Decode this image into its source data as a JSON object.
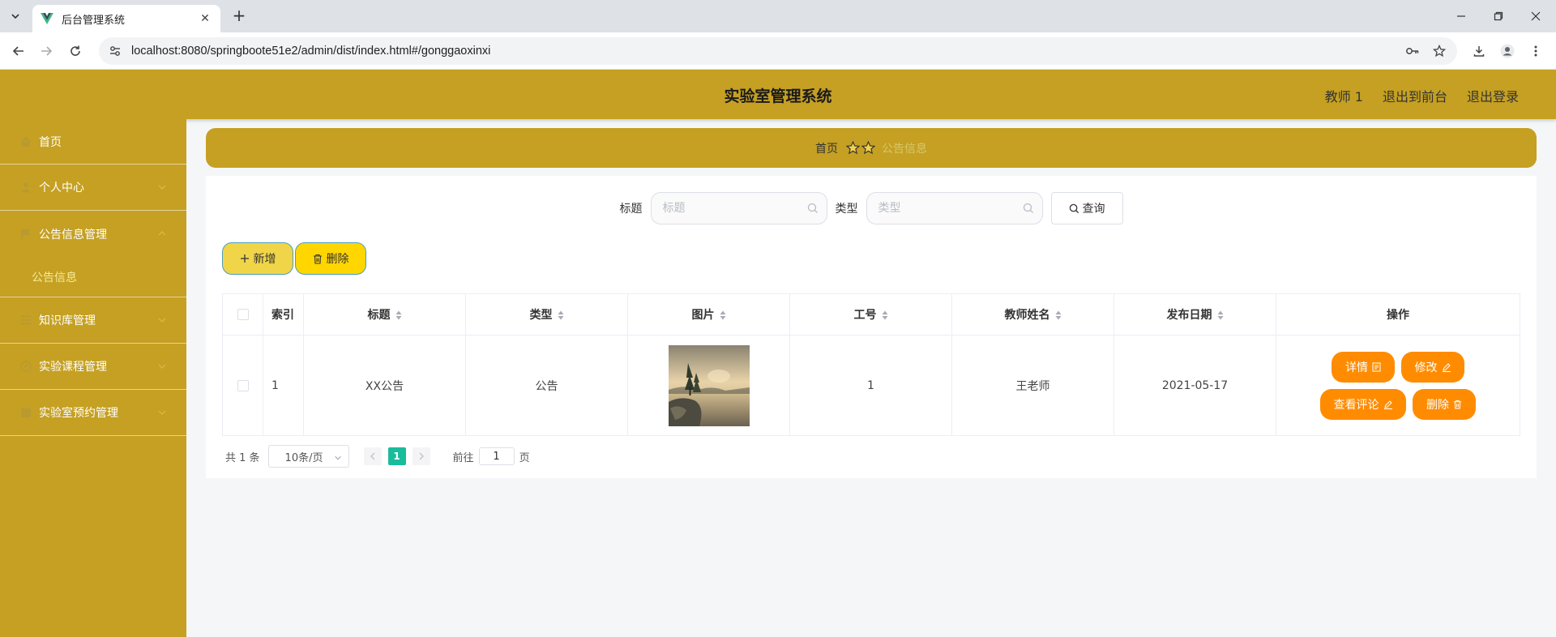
{
  "browser": {
    "tab_title": "后台管理系统",
    "url": "localhost:8080/springboote51e2/admin/dist/index.html#/gonggaoxinxi"
  },
  "header": {
    "title": "实验室管理系统",
    "user": "教师 1",
    "to_front": "退出到前台",
    "logout": "退出登录"
  },
  "sidebar": {
    "items": [
      {
        "label": "首页"
      },
      {
        "label": "个人中心"
      },
      {
        "label": "公告信息管理"
      },
      {
        "label": "公告信息"
      },
      {
        "label": "知识库管理"
      },
      {
        "label": "实验课程管理"
      },
      {
        "label": "实验室预约管理"
      }
    ]
  },
  "breadcrumb": {
    "home": "首页",
    "current": "公告信息"
  },
  "search": {
    "title_label": "标题",
    "title_placeholder": "标题",
    "type_label": "类型",
    "type_placeholder": "类型",
    "query_label": "查询"
  },
  "actions": {
    "add_label": "新增",
    "delete_label": "删除"
  },
  "table": {
    "columns": [
      "索引",
      "标题",
      "类型",
      "图片",
      "工号",
      "教师姓名",
      "发布日期",
      "操作"
    ],
    "rows": [
      {
        "index": "1",
        "title": "XX公告",
        "type": "公告",
        "job_no": "1",
        "teacher": "王老师",
        "date": "2021-05-17"
      }
    ],
    "ops": {
      "detail": "详情",
      "edit": "修改",
      "comments": "查看评论",
      "delete": "删除"
    }
  },
  "pagination": {
    "total": "共 1 条",
    "page_size": "10条/页",
    "current_page": "1",
    "goto_prefix": "前往",
    "goto_value": "1",
    "goto_suffix": "页"
  },
  "colors": {
    "theme": "#c5a022",
    "op_button": "#ff8c00",
    "page_active": "#1abc9c"
  }
}
